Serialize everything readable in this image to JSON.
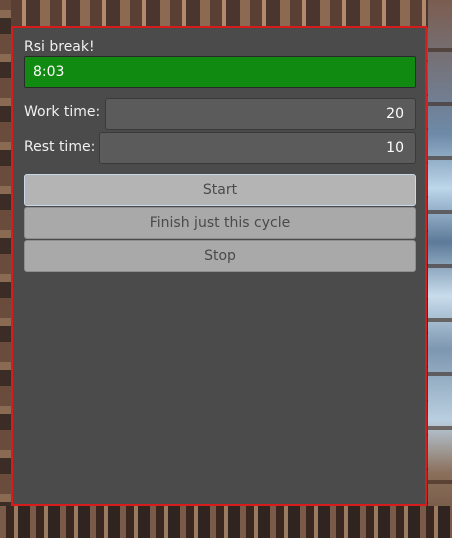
{
  "window": {
    "title": "Rsi break!",
    "frame_color": "#d81c1c",
    "background": "#4b4b4b"
  },
  "timer": {
    "remaining": "8:03",
    "progress_fraction": 1.0,
    "bar_color": "#118a11"
  },
  "settings": {
    "work_time_label": "Work time:",
    "work_time_value": "20",
    "rest_time_label": "Rest time:",
    "rest_time_value": "10"
  },
  "buttons": {
    "start_label": "Start",
    "finish_cycle_label": "Finish just this cycle",
    "stop_label": "Stop"
  }
}
